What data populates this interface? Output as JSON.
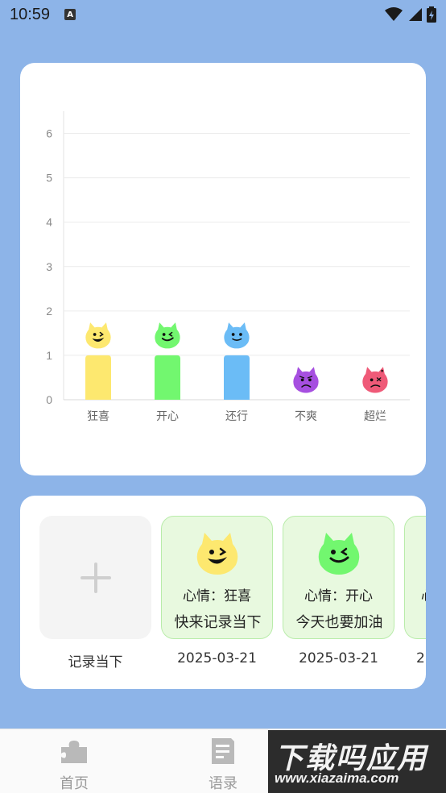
{
  "status_bar": {
    "time": "10:59",
    "notification_icon": "a-letter-icon",
    "icons": [
      "wifi-icon",
      "signal-icon",
      "battery-charging-icon"
    ]
  },
  "chart_data": {
    "type": "bar",
    "categories": [
      "狂喜",
      "开心",
      "还行",
      "不爽",
      "超烂"
    ],
    "values": [
      1,
      1,
      1,
      0,
      0
    ],
    "ylim": [
      0,
      6.5
    ],
    "yticks": [
      "0",
      "1",
      "2",
      "3",
      "4",
      "5",
      "6"
    ],
    "grid": true,
    "colors": [
      "#fde86f",
      "#72f76f",
      "#6bbcf6",
      "#a64fe0",
      "#ef5a78"
    ],
    "face_icons": [
      "ecstatic-face-icon",
      "happy-face-icon",
      "okay-face-icon",
      "annoyed-face-icon",
      "awful-face-icon"
    ]
  },
  "records": {
    "add_caption": "记录当下",
    "items": [
      {
        "mood_text": "心情：狂喜",
        "note": "快来记录当下",
        "date": "2025-03-21",
        "face": "ecstatic-face-icon",
        "color": "#fde86f"
      },
      {
        "mood_text": "心情：开心",
        "note": "今天也要加油",
        "date": "2025-03-21",
        "face": "happy-face-icon",
        "color": "#72f76f"
      },
      {
        "mood_text": "心",
        "note": "",
        "date": "2",
        "face": "",
        "color": "#72f76f"
      }
    ]
  },
  "nav": {
    "home": "首页",
    "quotes": "语录",
    "home_icon": "puzzle-piece-icon",
    "quotes_icon": "document-icon"
  },
  "watermark": {
    "title": "下载吗应用",
    "url": "www.xiazaima.com"
  }
}
